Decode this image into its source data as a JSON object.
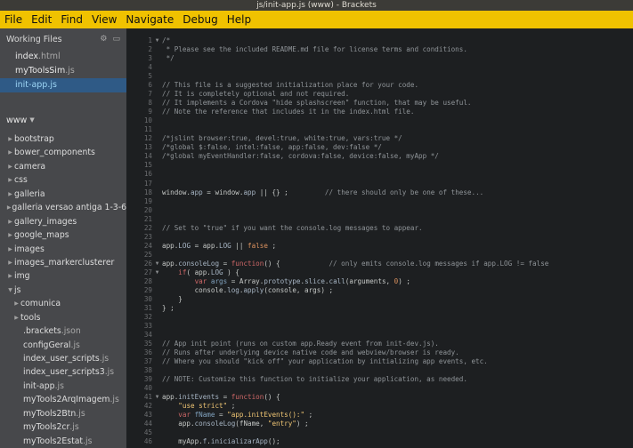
{
  "window": {
    "title": "js/init-app.js (www) - Brackets"
  },
  "menu": [
    "File",
    "Edit",
    "Find",
    "View",
    "Navigate",
    "Debug",
    "Help"
  ],
  "sidebar": {
    "working_files_title": "Working Files",
    "working_files": [
      {
        "name": "index",
        "ext": ".html",
        "selected": false,
        "active": false
      },
      {
        "name": "myToolsSim",
        "ext": ".js",
        "selected": false,
        "active": false
      },
      {
        "name": "init-app",
        "ext": ".js",
        "selected": true,
        "active": true
      }
    ],
    "project_title": "www",
    "tree": [
      {
        "name": "bootstrap",
        "ext": "",
        "type": "folder",
        "depth": 0
      },
      {
        "name": "bower_components",
        "ext": "",
        "type": "folder",
        "depth": 0
      },
      {
        "name": "camera",
        "ext": "",
        "type": "folder",
        "depth": 0
      },
      {
        "name": "css",
        "ext": "",
        "type": "folder",
        "depth": 0
      },
      {
        "name": "galleria",
        "ext": "",
        "type": "folder",
        "depth": 0
      },
      {
        "name": "galleria versao antiga 1-3-6",
        "ext": "",
        "type": "folder",
        "depth": 0
      },
      {
        "name": "gallery_images",
        "ext": "",
        "type": "folder",
        "depth": 0
      },
      {
        "name": "google_maps",
        "ext": "",
        "type": "folder",
        "depth": 0
      },
      {
        "name": "images",
        "ext": "",
        "type": "folder",
        "depth": 0
      },
      {
        "name": "images_markerclusterer",
        "ext": "",
        "type": "folder",
        "depth": 0
      },
      {
        "name": "img",
        "ext": "",
        "type": "folder",
        "depth": 0
      },
      {
        "name": "js",
        "ext": "",
        "type": "folder-open",
        "depth": 0
      },
      {
        "name": "comunica",
        "ext": "",
        "type": "folder",
        "depth": 1
      },
      {
        "name": "tools",
        "ext": "",
        "type": "folder",
        "depth": 1
      },
      {
        "name": ".brackets",
        "ext": ".json",
        "type": "file",
        "depth": 1
      },
      {
        "name": "configGeral",
        "ext": ".js",
        "type": "file",
        "depth": 1
      },
      {
        "name": "index_user_scripts",
        "ext": ".js",
        "type": "file",
        "depth": 1
      },
      {
        "name": "index_user_scripts3",
        "ext": ".js",
        "type": "file",
        "depth": 1
      },
      {
        "name": "init-app",
        "ext": ".js",
        "type": "file",
        "depth": 1
      },
      {
        "name": "myTools2ArqImagem",
        "ext": ".js",
        "type": "file",
        "depth": 1
      },
      {
        "name": "myTools2Btn",
        "ext": ".js",
        "type": "file",
        "depth": 1
      },
      {
        "name": "myTools2cr",
        "ext": ".js",
        "type": "file",
        "depth": 1
      },
      {
        "name": "myTools2Estat",
        "ext": ".js",
        "type": "file",
        "depth": 1
      }
    ]
  },
  "editor": {
    "lines": [
      {
        "num": "1",
        "fold": "▼",
        "segs": [
          [
            "c",
            "/*"
          ]
        ]
      },
      {
        "num": "2",
        "fold": "",
        "segs": [
          [
            "c",
            " * Please see the included README.md file for license terms and conditions."
          ]
        ]
      },
      {
        "num": "3",
        "fold": "",
        "segs": [
          [
            "c",
            " */"
          ]
        ]
      },
      {
        "num": "4",
        "fold": "",
        "segs": []
      },
      {
        "num": "5",
        "fold": "",
        "segs": []
      },
      {
        "num": "6",
        "fold": "",
        "segs": [
          [
            "c",
            "// This file is a suggested initialization place for your code."
          ]
        ]
      },
      {
        "num": "7",
        "fold": "",
        "segs": [
          [
            "c",
            "// It is completely optional and not required."
          ]
        ]
      },
      {
        "num": "8",
        "fold": "",
        "segs": [
          [
            "c",
            "// It implements a Cordova \"hide splashscreen\" function, that may be useful."
          ]
        ]
      },
      {
        "num": "9",
        "fold": "",
        "segs": [
          [
            "c",
            "// Note the reference that includes it in the index.html file."
          ]
        ]
      },
      {
        "num": "10",
        "fold": "",
        "segs": []
      },
      {
        "num": "11",
        "fold": "",
        "segs": []
      },
      {
        "num": "12",
        "fold": "",
        "segs": [
          [
            "c",
            "/*jslint browser:true, devel:true, white:true, vars:true */"
          ]
        ]
      },
      {
        "num": "13",
        "fold": "",
        "segs": [
          [
            "c",
            "/*global $:false, intel:false, app:false, dev:false */"
          ]
        ]
      },
      {
        "num": "14",
        "fold": "",
        "segs": [
          [
            "c",
            "/*global myEventHandler:false, cordova:false, device:false, myApp */"
          ]
        ]
      },
      {
        "num": "15",
        "fold": "",
        "segs": []
      },
      {
        "num": "16",
        "fold": "",
        "segs": []
      },
      {
        "num": "17",
        "fold": "",
        "segs": []
      },
      {
        "num": "18",
        "fold": "",
        "segs": [
          [
            "t",
            "window."
          ],
          [
            "d",
            "app"
          ],
          [
            "t",
            " = window."
          ],
          [
            "d",
            "app"
          ],
          [
            "t",
            " || {} ;         "
          ],
          [
            "c",
            "// there should only be one of these..."
          ]
        ]
      },
      {
        "num": "19",
        "fold": "",
        "segs": []
      },
      {
        "num": "20",
        "fold": "",
        "segs": []
      },
      {
        "num": "21",
        "fold": "",
        "segs": []
      },
      {
        "num": "22",
        "fold": "",
        "segs": [
          [
            "c",
            "// Set to \"true\" if you want the console.log messages to appear."
          ]
        ]
      },
      {
        "num": "23",
        "fold": "",
        "segs": []
      },
      {
        "num": "24",
        "fold": "",
        "segs": [
          [
            "t",
            "app."
          ],
          [
            "d",
            "LOG"
          ],
          [
            "t",
            " = app."
          ],
          [
            "d",
            "LOG"
          ],
          [
            "t",
            " || "
          ],
          [
            "n",
            "false"
          ],
          [
            "t",
            " ;"
          ]
        ]
      },
      {
        "num": "25",
        "fold": "",
        "segs": []
      },
      {
        "num": "26",
        "fold": "▼",
        "segs": [
          [
            "t",
            "app."
          ],
          [
            "d",
            "consoleLog"
          ],
          [
            "t",
            " = "
          ],
          [
            "k",
            "function"
          ],
          [
            "t",
            "() {            "
          ],
          [
            "c",
            "// only emits console.log messages if app.LOG != false"
          ]
        ]
      },
      {
        "num": "27",
        "fold": "▼",
        "segs": [
          [
            "t",
            "    "
          ],
          [
            "k",
            "if"
          ],
          [
            "t",
            "( app."
          ],
          [
            "d",
            "LOG"
          ],
          [
            "t",
            " ) {"
          ]
        ]
      },
      {
        "num": "28",
        "fold": "",
        "segs": [
          [
            "t",
            "        "
          ],
          [
            "k",
            "var"
          ],
          [
            "t",
            " "
          ],
          [
            "f",
            "args"
          ],
          [
            "t",
            " = Array."
          ],
          [
            "d",
            "prototype"
          ],
          [
            "t",
            "."
          ],
          [
            "d",
            "slice"
          ],
          [
            "t",
            "."
          ],
          [
            "d",
            "call"
          ],
          [
            "t",
            "(arguments, "
          ],
          [
            "n",
            "0"
          ],
          [
            "t",
            ") ;"
          ]
        ]
      },
      {
        "num": "29",
        "fold": "",
        "segs": [
          [
            "t",
            "        console."
          ],
          [
            "d",
            "log"
          ],
          [
            "t",
            "."
          ],
          [
            "d",
            "apply"
          ],
          [
            "t",
            "(console, args) ;"
          ]
        ]
      },
      {
        "num": "30",
        "fold": "",
        "segs": [
          [
            "t",
            "    }"
          ]
        ]
      },
      {
        "num": "31",
        "fold": "",
        "segs": [
          [
            "t",
            "} ;"
          ]
        ]
      },
      {
        "num": "32",
        "fold": "",
        "segs": []
      },
      {
        "num": "33",
        "fold": "",
        "segs": []
      },
      {
        "num": "34",
        "fold": "",
        "segs": []
      },
      {
        "num": "35",
        "fold": "",
        "segs": [
          [
            "c",
            "// App init point (runs on custom app.Ready event from init-dev.js)."
          ]
        ]
      },
      {
        "num": "36",
        "fold": "",
        "segs": [
          [
            "c",
            "// Runs after underlying device native code and webview/browser is ready."
          ]
        ]
      },
      {
        "num": "37",
        "fold": "",
        "segs": [
          [
            "c",
            "// Where you should \"kick off\" your application by initializing app events, etc."
          ]
        ]
      },
      {
        "num": "38",
        "fold": "",
        "segs": []
      },
      {
        "num": "39",
        "fold": "",
        "segs": [
          [
            "c",
            "// NOTE: Customize this function to initialize your application, as needed."
          ]
        ]
      },
      {
        "num": "40",
        "fold": "",
        "segs": []
      },
      {
        "num": "41",
        "fold": "▼",
        "segs": [
          [
            "t",
            "app."
          ],
          [
            "d",
            "initEvents"
          ],
          [
            "t",
            " = "
          ],
          [
            "k",
            "function"
          ],
          [
            "t",
            "() {"
          ]
        ]
      },
      {
        "num": "42",
        "fold": "",
        "segs": [
          [
            "t",
            "    "
          ],
          [
            "s",
            "\"use strict\""
          ],
          [
            "t",
            " ;"
          ]
        ]
      },
      {
        "num": "43",
        "fold": "",
        "segs": [
          [
            "t",
            "    "
          ],
          [
            "k",
            "var"
          ],
          [
            "t",
            " "
          ],
          [
            "f",
            "fName"
          ],
          [
            "t",
            " = "
          ],
          [
            "s",
            "\"app.initEvents():\""
          ],
          [
            "t",
            " ;"
          ]
        ]
      },
      {
        "num": "44",
        "fold": "",
        "segs": [
          [
            "t",
            "    app."
          ],
          [
            "d",
            "consoleLog"
          ],
          [
            "t",
            "(fName, "
          ],
          [
            "s",
            "\"entry\""
          ],
          [
            "t",
            ") ;"
          ]
        ]
      },
      {
        "num": "45",
        "fold": "",
        "segs": []
      },
      {
        "num": "46",
        "fold": "",
        "segs": [
          [
            "t",
            "    myApp."
          ],
          [
            "d",
            "f"
          ],
          [
            "t",
            "."
          ],
          [
            "d",
            "inicializarApp"
          ],
          [
            "t",
            "();"
          ]
        ]
      }
    ]
  }
}
